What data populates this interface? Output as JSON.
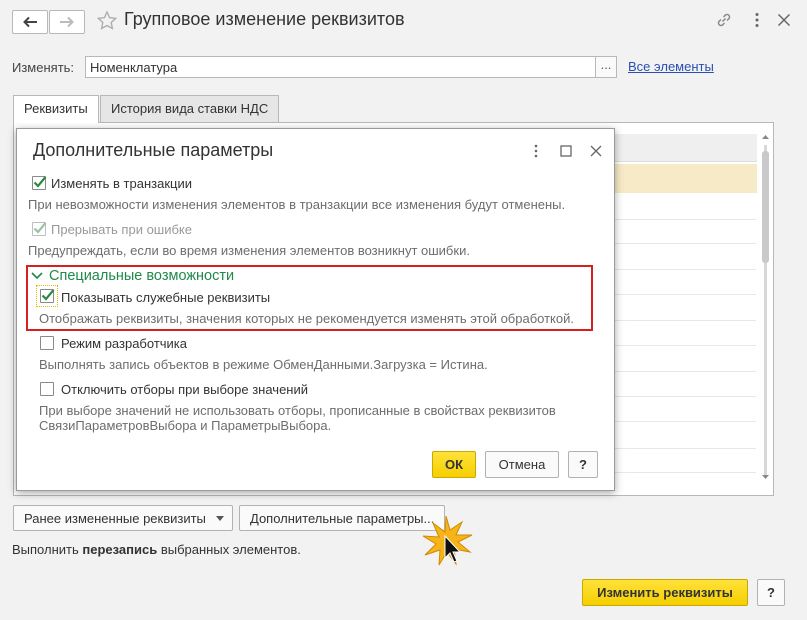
{
  "window": {
    "title": "Групповое изменение реквизитов",
    "icons": [
      "back-arrow-icon",
      "forward-arrow-icon",
      "star-icon",
      "link-icon",
      "more-vertical-icon",
      "close-icon"
    ]
  },
  "change": {
    "label": "Изменять:",
    "value": "Номенклатура",
    "dots": "...",
    "all_link": "Все элементы"
  },
  "tabs": [
    {
      "label": "Реквизиты",
      "active": true
    },
    {
      "label": "История вида ставки НДС",
      "active": false
    }
  ],
  "bottom": {
    "prev_changed_button": "Ранее измененные реквизиты",
    "extra_params_button": "Дополнительные параметры...",
    "status_text_prefix": "Выполнить ",
    "status_text_bold": "перезапись",
    "status_text_suffix": " выбранных элементов.",
    "change_button": "Изменить реквизиты",
    "help_button": "?"
  },
  "dialog": {
    "title": "Дополнительные параметры",
    "options": [
      {
        "label": "Изменять в транзакции",
        "checked": true,
        "disabled": false,
        "hint": "При невозможности изменения элементов в транзакции все изменения будут отменены."
      },
      {
        "label": "Прерывать при ошибке",
        "checked": true,
        "disabled": true,
        "hint": "Предупреждать, если во время изменения элементов возникнут ошибки."
      }
    ],
    "section_title": "Специальные возможности",
    "special": [
      {
        "label": "Показывать служебные реквизиты",
        "checked": true,
        "hint": "Отображать реквизиты, значения которых не рекомендуется изменять этой обработкой."
      },
      {
        "label": "Режим разработчика",
        "checked": false,
        "hint": "Выполнять запись объектов в режиме ОбменДанными.Загрузка = Истина."
      },
      {
        "label": "Отключить отборы при выборе значений",
        "checked": false,
        "hint_line1": "При выборе значений не использовать отборы, прописанные в свойствах реквизитов",
        "hint_line2": "СвязиПараметровВыбора и ПараметрыВыбора."
      }
    ],
    "ok_button": "ОК",
    "cancel_button": "Отмена",
    "help_button": "?"
  },
  "colors": {
    "accent_yellow": "#f5cf00",
    "section_green": "#1e8a4a",
    "highlight_red": "#d61f1f",
    "link_blue": "#2a4fb3",
    "selected_row": "#f7eac6"
  }
}
